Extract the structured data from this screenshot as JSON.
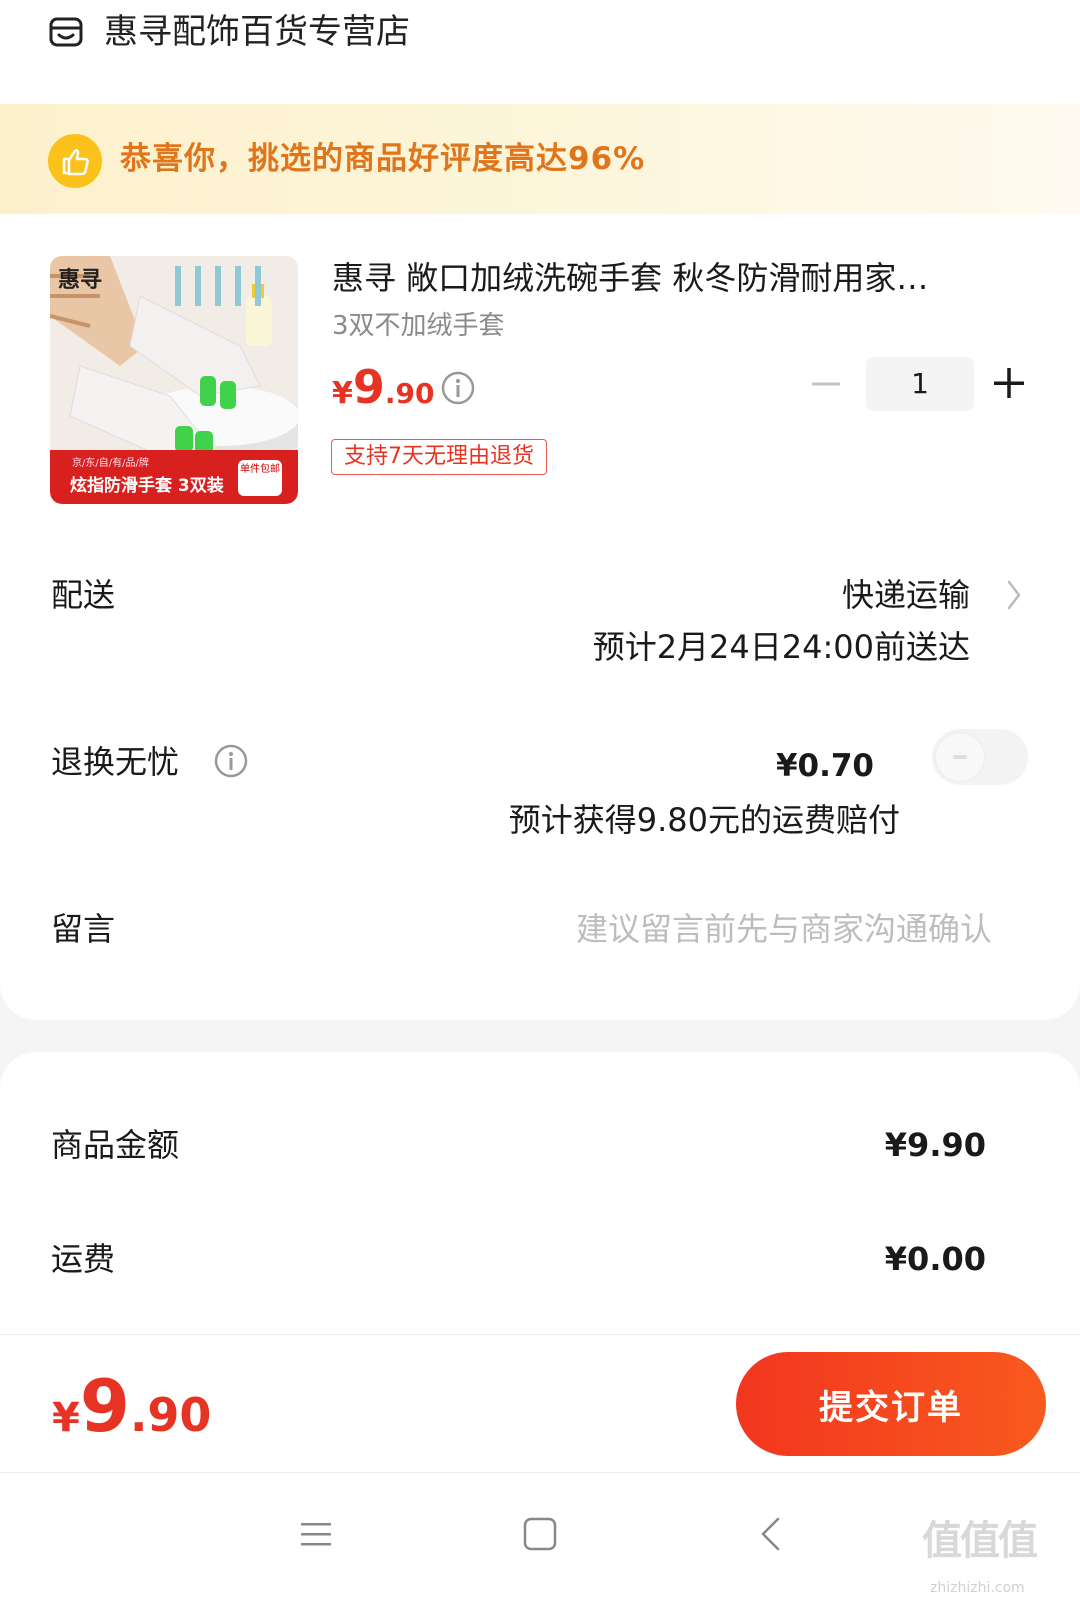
{
  "shop": {
    "name": "惠寻配饰百货专营店",
    "icon": "store-icon"
  },
  "banner": {
    "text": "恭喜你，挑选的商品好评度高达96%",
    "icon": "thumbs-up-icon",
    "text_color": "#e0761b"
  },
  "product": {
    "title": "惠寻 敞口加绒洗碗手套 秋冬防滑耐用家…",
    "variant": "3双不加绒手套",
    "price": {
      "yen": "¥",
      "integer": "9",
      "decimal": ".90"
    },
    "quantity": "1",
    "return_tag": "支持7天无理由退货",
    "image": {
      "brand": "惠寻",
      "label_small": "京/东/自/有/品/牌",
      "label": "炫指防滑手套 3双装",
      "tag": "单件包邮"
    }
  },
  "delivery": {
    "label": "配送",
    "method": "快递运输",
    "eta": "预计2月24日24:00前送达"
  },
  "return_insurance": {
    "label": "退换无忧",
    "price": "¥0.70",
    "note": "预计获得9.80元的运费赔付",
    "enabled": false
  },
  "message": {
    "label": "留言",
    "placeholder": "建议留言前先与商家沟通确认"
  },
  "summary": {
    "goods_label": "商品金额",
    "goods_value": "¥9.90",
    "shipping_label": "运费",
    "shipping_value": "¥0.00"
  },
  "footer": {
    "total": {
      "yen": "¥",
      "integer": "9",
      "decimal": ".90"
    },
    "submit_label": "提交订单"
  },
  "watermark": {
    "text": "值值值",
    "url": "zhizhizhi.com"
  },
  "colors": {
    "accent": "#e63323",
    "button": "#f2361f",
    "banner_bg": "#fdf1cc"
  }
}
